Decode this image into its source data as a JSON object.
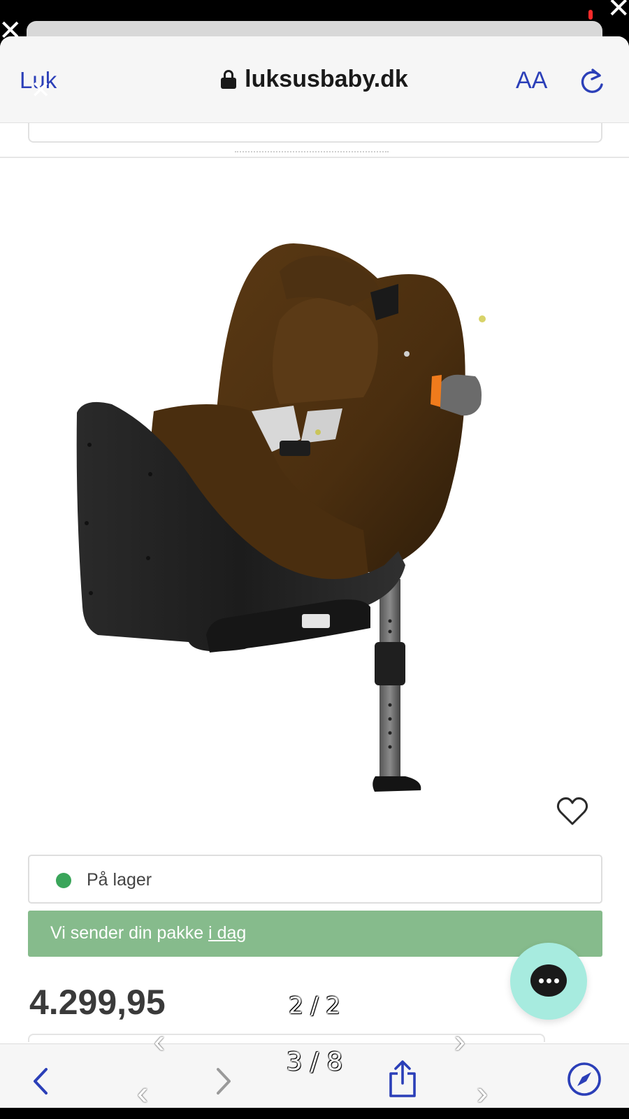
{
  "browser": {
    "close_label": "Luk",
    "domain": "luksusbaby.dk",
    "text_size_label": "AA"
  },
  "product": {
    "stock_status": "På lager",
    "shipping_text": "Vi sender din pakke ",
    "shipping_link": "i dag",
    "price": "4.299,95"
  },
  "viewer": {
    "inner_counter": "2 / 2",
    "outer_counter": "3 / 8"
  },
  "colors": {
    "accent": "#2b3fb8",
    "in_stock": "#3aa55a",
    "shipping_banner": "#86bb8c",
    "chat_button": "#a7ebdf"
  },
  "icons": {
    "browser": [
      "lock-icon",
      "reload-icon"
    ],
    "page": [
      "heart-icon",
      "chat-icon"
    ],
    "toolbar": [
      "back-icon",
      "forward-icon",
      "share-icon",
      "compass-icon"
    ]
  }
}
